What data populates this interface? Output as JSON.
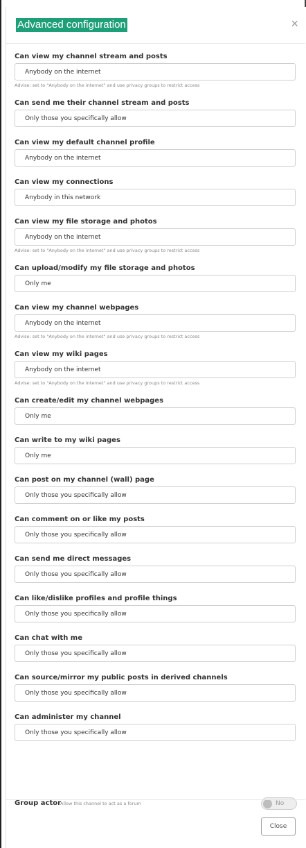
{
  "dialog": {
    "title": "Advanced configuration",
    "close_icon": "×",
    "close_button": "Close"
  },
  "permissions": [
    {
      "label": "Can view my channel stream and posts",
      "value": "Anybody on the internet",
      "hint": "Advise: set to \"Anybody on the internet\" and use privacy groups to restrict access"
    },
    {
      "label": "Can send me their channel stream and posts",
      "value": "Only those you specifically allow"
    },
    {
      "label": "Can view my default channel profile",
      "value": "Anybody on the internet"
    },
    {
      "label": "Can view my connections",
      "value": "Anybody in this network"
    },
    {
      "label": "Can view my file storage and photos",
      "value": "Anybody on the internet",
      "hint": "Advise: set to \"Anybody on the internet\" and use privacy groups to restrict access"
    },
    {
      "label": "Can upload/modify my file storage and photos",
      "value": "Only me"
    },
    {
      "label": "Can view my channel webpages",
      "value": "Anybody on the internet",
      "hint": "Advise: set to \"Anybody on the internet\" and use privacy groups to restrict access"
    },
    {
      "label": "Can view my wiki pages",
      "value": "Anybody on the internet",
      "hint": "Advise: set to \"Anybody on the internet\" and use privacy groups to restrict access"
    },
    {
      "label": "Can create/edit my channel webpages",
      "value": "Only me"
    },
    {
      "label": "Can write to my wiki pages",
      "value": "Only me"
    },
    {
      "label": "Can post on my channel (wall) page",
      "value": "Only those you specifically allow"
    },
    {
      "label": "Can comment on or like my posts",
      "value": "Only those you specifically allow"
    },
    {
      "label": "Can send me direct messages",
      "value": "Only those you specifically allow"
    },
    {
      "label": "Can like/dislike profiles and profile things",
      "value": "Only those you specifically allow"
    },
    {
      "label": "Can chat with me",
      "value": "Only those you specifically allow"
    },
    {
      "label": "Can source/mirror my public posts in derived channels",
      "value": "Only those you specifically allow"
    },
    {
      "label": "Can administer my channel",
      "value": "Only those you specifically allow"
    }
  ],
  "group_actor": {
    "label": "Group actor",
    "description": "Allow this channel to act as a forum",
    "toggle_text": "No",
    "enabled": false
  }
}
